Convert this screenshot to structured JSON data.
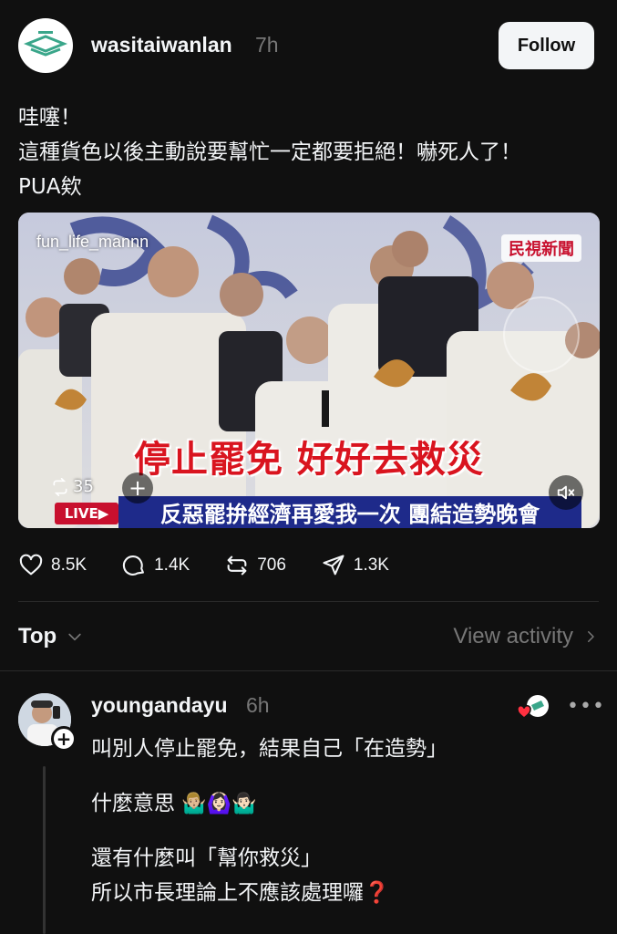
{
  "post": {
    "username": "wasitaiwanlan",
    "time": "7h",
    "follow_label": "Follow",
    "text_lines": [
      "哇噻！",
      "這種貨色以後主動說要幫忙一定都要拒絕！嚇死人了！",
      "PUA欸"
    ],
    "media": {
      "watermark": "fun_life_mannn",
      "channel_logo": "民視新聞",
      "caption": "停止罷免 好好去救災",
      "ticker": "反惡罷拚經濟再愛我一次 團結造勢晚會",
      "live_badge": "LIVE▶",
      "repost_count": "35",
      "plus_label": "+",
      "colors": {
        "caption": "#d9141f",
        "ticker_bg": "#1e2a8a",
        "live_bg": "#c8102e"
      }
    },
    "stats": {
      "likes": "8.5K",
      "comments": "1.4K",
      "reposts": "706",
      "shares": "1.3K"
    }
  },
  "sort": {
    "label": "Top",
    "view_activity": "View activity"
  },
  "reply": {
    "username": "youngandayu",
    "time": "6h",
    "more_label": "•••",
    "line1": "叫別人停止罷免，結果自己「在造勢」",
    "line2": "什麼意思",
    "line2_emojis": "🤷🏼‍♂️🙆🏻‍♀️🤷🏻‍♂️",
    "line3": "還有什麼叫「幫你救災」",
    "line4": "所以市長理論上不應該處理囉",
    "line4_mark": "❓"
  },
  "icons": {
    "like": "heart-icon",
    "comment": "comment-bubble-icon",
    "repost": "repost-icon",
    "share": "send-icon",
    "chevron_down": "chevron-down-icon",
    "chevron_right": "chevron-right-icon",
    "mute": "speaker-muted-icon"
  }
}
